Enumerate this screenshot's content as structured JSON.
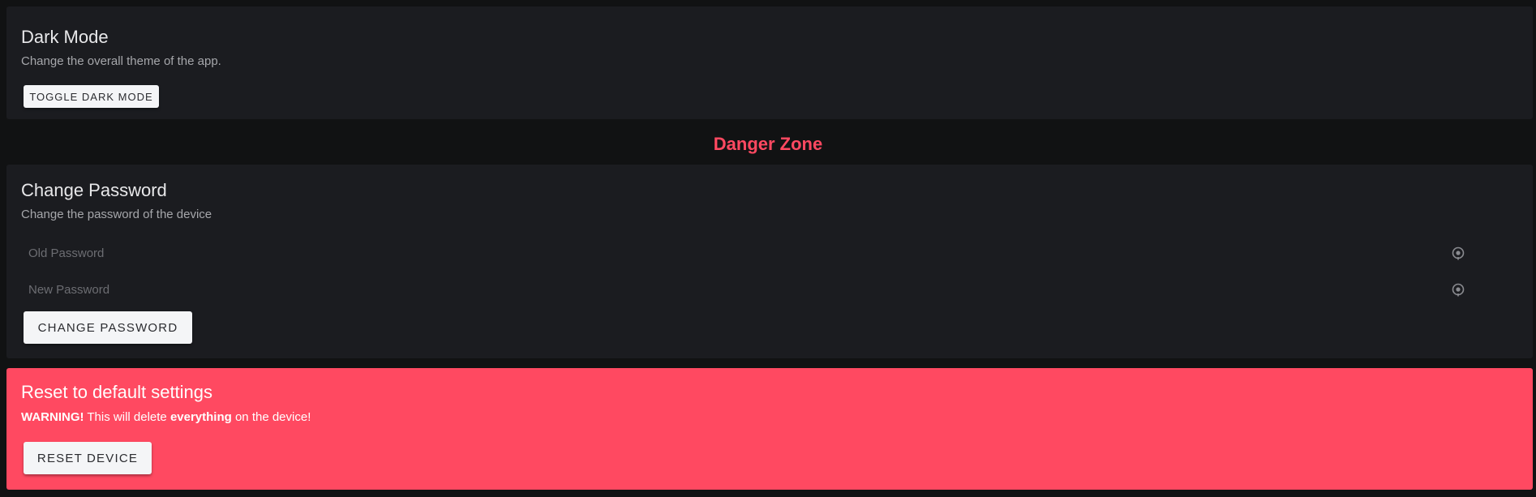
{
  "dark_mode": {
    "title": "Dark Mode",
    "description": "Change the overall theme of the app.",
    "button_label": "TOGGLE DARK MODE"
  },
  "danger_zone": {
    "heading": "Danger Zone"
  },
  "change_password": {
    "title": "Change Password",
    "description": "Change the password of the device",
    "old_password": {
      "value": "",
      "placeholder": "Old Password",
      "icon": "eye-icon"
    },
    "new_password": {
      "value": "",
      "placeholder": "New Password",
      "icon": "eye-icon"
    },
    "button_label": "CHANGE PASSWORD"
  },
  "reset": {
    "title": "Reset to default settings",
    "warning_prefix": "WARNING!",
    "warning_mid": " This will delete ",
    "warning_emph": "everything",
    "warning_suffix": " on the device!",
    "button_label": "RESET DEVICE"
  },
  "colors": {
    "background": "#111213",
    "card": "#1b1c20",
    "danger": "#ff4961",
    "button": "#f4f5f7"
  }
}
